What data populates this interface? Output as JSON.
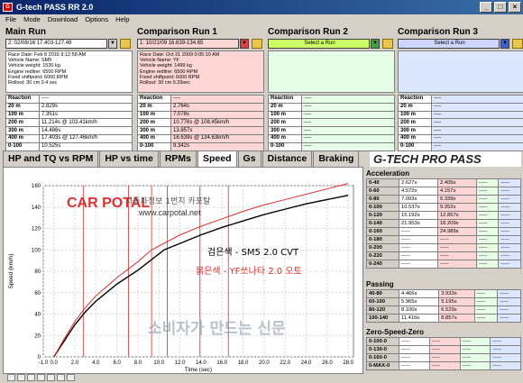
{
  "window": {
    "title": "G-tech PASS RR 2.0",
    "icon": "G"
  },
  "menu": [
    "File",
    "Mode",
    "Download",
    "Options",
    "Help"
  ],
  "panels": [
    {
      "title": "Main Run",
      "selected": "2:  02/08/16 17.403-127.49",
      "bg": "#ffffff",
      "info": [
        "Race Date: Feb 8 2016  9:12:58 AM",
        "Vehicle Name: SM5",
        "Vehicle weight: 1530 kg",
        "Engine redline: 6500 RPM",
        "Fixed shiftpoint: 6000 RPM",
        "Rollout: 30 cm  0.4 sec"
      ],
      "results": [
        [
          "Reaction",
          "----"
        ],
        [
          "20 m",
          "2.829s"
        ],
        [
          "100 m",
          "7.351s"
        ],
        [
          "200 m",
          "11.214s @ 103.41km/h"
        ],
        [
          "300 m",
          "14.486s"
        ],
        [
          "400 m",
          "17.403s @ 127.46km/h"
        ],
        [
          "0-100",
          "10.525s"
        ]
      ]
    },
    {
      "title": "Comparison Run 1",
      "selected": "1:  10/21/09 16.639-134.65",
      "bg": "#ffd6d6",
      "info": [
        "Race Date: Oct 21 2009  0:05:10 AM",
        "Vehicle Name: YF",
        "Vehicle weight: 1499 kg",
        "Engine redline: 6500 RPM",
        "Fixed shiftpoint: 6000 RPM",
        "Rollout: 30 cm  0.29sec"
      ],
      "results": [
        [
          "Reaction",
          "----"
        ],
        [
          "20 m",
          "2.764s"
        ],
        [
          "100 m",
          "7.078s"
        ],
        [
          "200 m",
          "10.776s @ 108.45km/h"
        ],
        [
          "300 m",
          "13.857s"
        ],
        [
          "400 m",
          "16.639s @ 134.63km/h"
        ],
        [
          "0-100",
          "9.342s"
        ]
      ]
    },
    {
      "title": "Comparison Run 2",
      "selected": "Select a Run",
      "bg": "#e6ffe6",
      "info": [],
      "results": [
        [
          "Reaction",
          "----"
        ],
        [
          "20 m",
          "----"
        ],
        [
          "100 m",
          "----"
        ],
        [
          "200 m",
          "----"
        ],
        [
          "300 m",
          "----"
        ],
        [
          "400 m",
          "----"
        ],
        [
          "0-100",
          "----"
        ]
      ]
    },
    {
      "title": "Comparison Run 3",
      "selected": "Select a Run",
      "bg": "#dde6ff",
      "info": [],
      "results": [
        [
          "Reaction",
          "----"
        ],
        [
          "20 m",
          "----"
        ],
        [
          "100 m",
          "----"
        ],
        [
          "200 m",
          "----"
        ],
        [
          "300 m",
          "----"
        ],
        [
          "400 m",
          "----"
        ],
        [
          "0-100",
          "----"
        ]
      ]
    }
  ],
  "tabs": [
    "HP and TQ vs RPM",
    "HP vs time",
    "RPMs",
    "Speed",
    "Gs",
    "Distance",
    "Braking"
  ],
  "active_tab": "Speed",
  "brand": "G-TECH PRO PASS",
  "chart_overlay": {
    "logo": "CAR POTAL",
    "site_title": "자동차정보 1번지 카포탈",
    "site_url": "www.carpotal.net",
    "legend_black": "검은색 - SM5 2.0 CVT",
    "legend_red": "붉은색 - YF쏘나타 2.0 오토",
    "watermark": "소비자가 만드는 신문"
  },
  "chart_data": {
    "type": "line",
    "xlabel": "Time (sec)",
    "ylabel": "Speed (km/h)",
    "xlim": [
      -1,
      28.5
    ],
    "ylim": [
      0,
      160
    ],
    "xticks": [
      "-1.0",
      "0.0",
      "2.0",
      "4.0",
      "6.0",
      "8.0",
      "10.0",
      "12.0",
      "14.0",
      "16.0",
      "18.0",
      "20.0",
      "22.0",
      "24.0",
      "26.0",
      "28.0"
    ],
    "yticks": [
      "0",
      "20",
      "40",
      "60",
      "80",
      "100",
      "120",
      "140",
      "160"
    ],
    "grid": true,
    "series": [
      {
        "color": "#000000",
        "x": [
          0,
          1,
          2,
          3,
          4,
          6,
          8,
          10.5,
          12,
          14,
          16,
          18,
          20,
          22,
          24,
          26,
          28
        ],
        "values": [
          0,
          15,
          30,
          42,
          52,
          68,
          81,
          100,
          106,
          114,
          121,
          127,
          133,
          138,
          143,
          147,
          151
        ]
      },
      {
        "color": "#e03030",
        "x": [
          0,
          1,
          2,
          3,
          4,
          6,
          8,
          9.3,
          12,
          14,
          16,
          18,
          20,
          22,
          24,
          26,
          28
        ],
        "values": [
          0,
          17,
          33,
          46,
          57,
          74,
          89,
          100,
          114,
          122,
          129,
          136,
          142,
          147,
          152,
          157,
          162
        ]
      }
    ],
    "vlines": [
      {
        "color": "#e03030",
        "x": [
          2.8,
          7.1,
          10.8,
          13.9,
          16.6,
          9.3
        ]
      }
    ]
  },
  "side": {
    "acceleration": {
      "title": "Acceleration",
      "rows": [
        [
          "0-40",
          "2.627s",
          "2.405s",
          "-----",
          "-----"
        ],
        [
          "0-60",
          "4.572s",
          "4.157s",
          "-----",
          "-----"
        ],
        [
          "0-80",
          "7.093s",
          "6.339s",
          "-----",
          "-----"
        ],
        [
          "0-100",
          "10.537s",
          "9.352s",
          "-----",
          "-----"
        ],
        [
          "0-120",
          "15.192s",
          "12.857s",
          "-----",
          "-----"
        ],
        [
          "0-140",
          "21.953s",
          "18.209s",
          "-----",
          "-----"
        ],
        [
          "0-160",
          "-----",
          "24.989s",
          "-----",
          "-----"
        ],
        [
          "0-180",
          "-----",
          "-----",
          "-----",
          "-----"
        ],
        [
          "0-200",
          "-----",
          "-----",
          "-----",
          "-----"
        ],
        [
          "0-220",
          "-----",
          "-----",
          "-----",
          "-----"
        ],
        [
          "0-240",
          "-----",
          "-----",
          "-----",
          "-----"
        ]
      ]
    },
    "passing": {
      "title": "Passing",
      "rows": [
        [
          "40-80",
          "4.466s",
          "3.933s",
          "-----",
          "-----"
        ],
        [
          "60-100",
          "5.965s",
          "5.195s",
          "-----",
          "-----"
        ],
        [
          "80-120",
          "8.100s",
          "6.529s",
          "-----",
          "-----"
        ],
        [
          "100-140",
          "11.416s",
          "8.857s",
          "-----",
          "-----"
        ]
      ]
    },
    "zero": {
      "title": "Zero-Speed-Zero",
      "rows": [
        [
          "0-100-0",
          "-----",
          "-----",
          "-----",
          "-----"
        ],
        [
          "0-130-0",
          "-----",
          "-----",
          "-----",
          "-----"
        ],
        [
          "0-160-0",
          "-----",
          "-----",
          "-----",
          "-----"
        ],
        [
          "0-MAX-0",
          "-----",
          "-----",
          "-----",
          "-----"
        ]
      ]
    }
  },
  "colors": {
    "main": "#ffffff",
    "comp1": "#ffd6d6",
    "comp2": "#e6ffe6",
    "comp3": "#dde6ff"
  }
}
